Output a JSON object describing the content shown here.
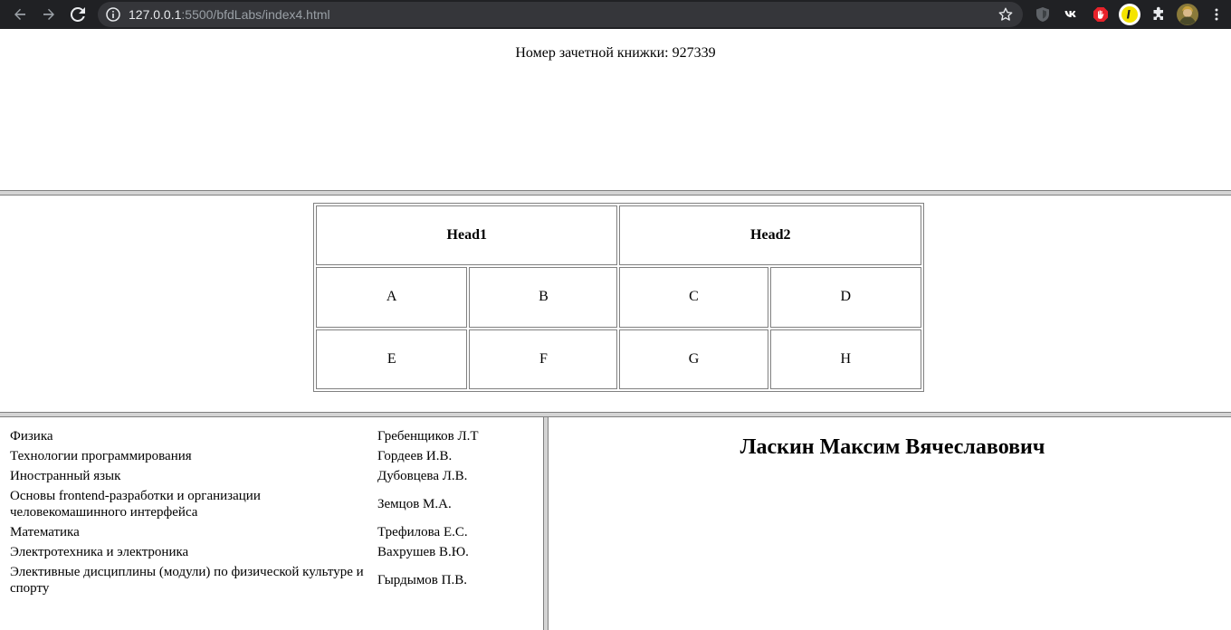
{
  "browser": {
    "url_host": "127.0.0.1",
    "url_rest": ":5500/bfdLabs/index4.html",
    "icons": [
      "back-icon",
      "forward-icon",
      "reload-icon",
      "info-icon",
      "star-icon",
      "shield-extension-icon",
      "vk-extension-icon",
      "adblock-extension-icon",
      "i-extension-icon",
      "puzzle-extension-icon",
      "profile-avatar",
      "menu-kebab-icon"
    ]
  },
  "top": {
    "record_book": "Номер зачетной книжки: 927339"
  },
  "grid": {
    "headers": [
      "Head1",
      "Head2"
    ],
    "rows": [
      [
        "A",
        "B",
        "C",
        "D"
      ],
      [
        "E",
        "F",
        "G",
        "H"
      ]
    ]
  },
  "subjects": [
    {
      "subject": "Физика",
      "teacher": "Гребенщиков Л.Т"
    },
    {
      "subject": "Технологии программирования",
      "teacher": "Гордеев И.В."
    },
    {
      "subject": "Иностранный язык",
      "teacher": "Дубовцева Л.В."
    },
    {
      "subject": "Основы frontend-разработки и организации человекомашинного интерфейса",
      "teacher": "Земцов М.А."
    },
    {
      "subject": "Математика",
      "teacher": "Трефилова Е.С."
    },
    {
      "subject": "Электротехника и электроника",
      "teacher": "Вахрушев В.Ю."
    },
    {
      "subject": "Элективные дисциплины (модули) по физической культуре и спорту",
      "teacher": "Гырдымов П.В."
    }
  ],
  "student": {
    "name": "Ласкин Максим Вячеславович"
  },
  "colors": {
    "chrome_bg": "#202124",
    "omnibox_bg": "#35363a",
    "frame_border": "#808080",
    "splitter": "#d4d4d4"
  }
}
